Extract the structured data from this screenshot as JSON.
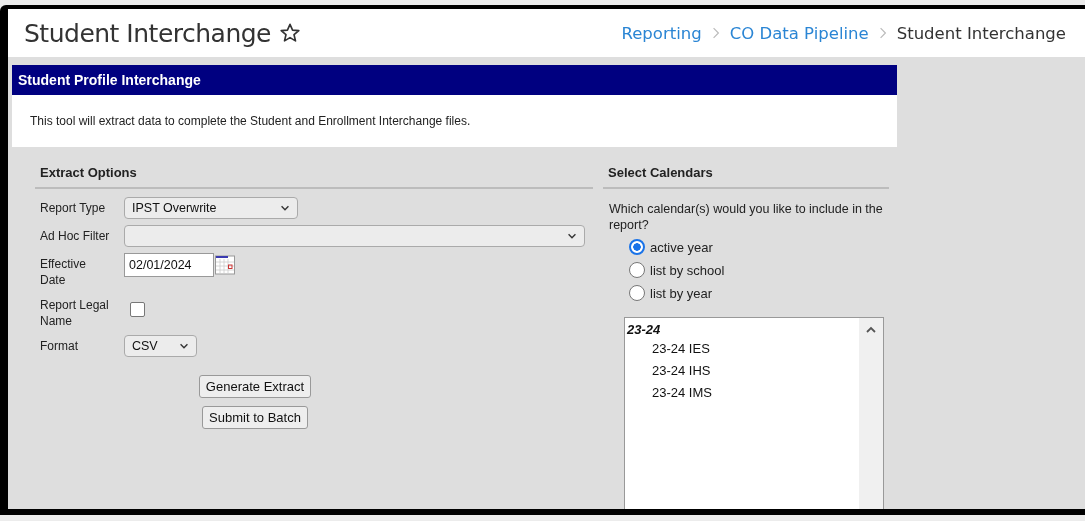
{
  "header": {
    "title": "Student Interchange",
    "favorite": false,
    "breadcrumb": [
      {
        "label": "Reporting",
        "link": true
      },
      {
        "label": "CO Data Pipeline",
        "link": true
      },
      {
        "label": "Student Interchange",
        "link": false
      }
    ]
  },
  "panel": {
    "title": "Student Profile Interchange",
    "description": "This tool will extract data to complete the Student and Enrollment Interchange files."
  },
  "extract_options": {
    "heading": "Extract Options",
    "fields": [
      {
        "kind": "select",
        "label": "Report Type",
        "value": "IPST Overwrite",
        "wide": false
      },
      {
        "kind": "select",
        "label": "Ad Hoc Filter",
        "wide": true
      },
      {
        "kind": "date",
        "label": "Effective Date",
        "value": "02/01/2024"
      },
      {
        "kind": "checkbox",
        "label": "Report Legal Name",
        "checked": false
      },
      {
        "kind": "select",
        "label": "Format",
        "value": "CSV",
        "wide": false
      }
    ],
    "buttons": [
      "Generate Extract",
      "Submit to Batch"
    ]
  },
  "select_calendars": {
    "heading": "Select Calendars",
    "prompt": "Which calendar(s) would you like to include in the report?",
    "options": [
      {
        "label": "active year",
        "selected": true
      },
      {
        "label": "list by school",
        "selected": false
      },
      {
        "label": "list by year",
        "selected": false
      }
    ],
    "calendar_list": [
      {
        "label": "23-24",
        "children": [
          {
            "label": "23-24 IES"
          },
          {
            "label": "23-24 IHS"
          },
          {
            "label": "23-24 IMS"
          }
        ]
      }
    ]
  }
}
